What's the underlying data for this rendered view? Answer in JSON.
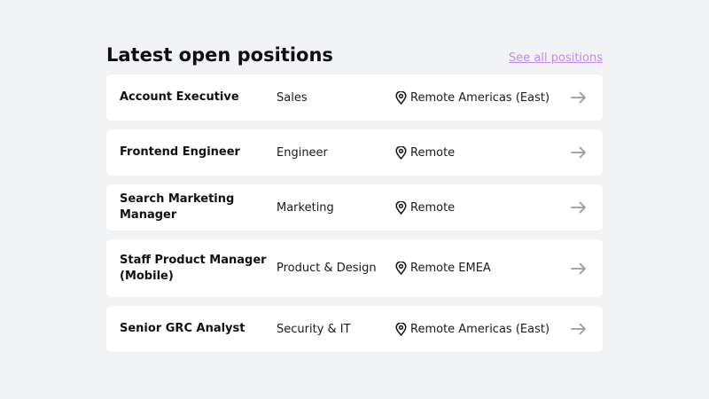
{
  "header": {
    "title": "Latest open positions",
    "see_all_label": "See all positions"
  },
  "colors": {
    "background": "#f2f3f5",
    "card": "#ffffff",
    "link": "#c08af0",
    "arrow": "#9a98a4"
  },
  "icons": {
    "location": "map-pin-icon",
    "open": "arrow-right-icon"
  },
  "jobs": [
    {
      "title": "Account Executive",
      "department": "Sales",
      "location": "Remote Americas (East)"
    },
    {
      "title": "Frontend Engineer",
      "department": "Engineer",
      "location": "Remote"
    },
    {
      "title": "Search Marketing Manager",
      "department": "Marketing",
      "location": "Remote"
    },
    {
      "title": "Staff Product Manager (Mobile)",
      "department": "Product & Design",
      "location": "Remote EMEA"
    },
    {
      "title": "Senior GRC Analyst",
      "department": "Security & IT",
      "location": "Remote Americas (East)"
    }
  ]
}
